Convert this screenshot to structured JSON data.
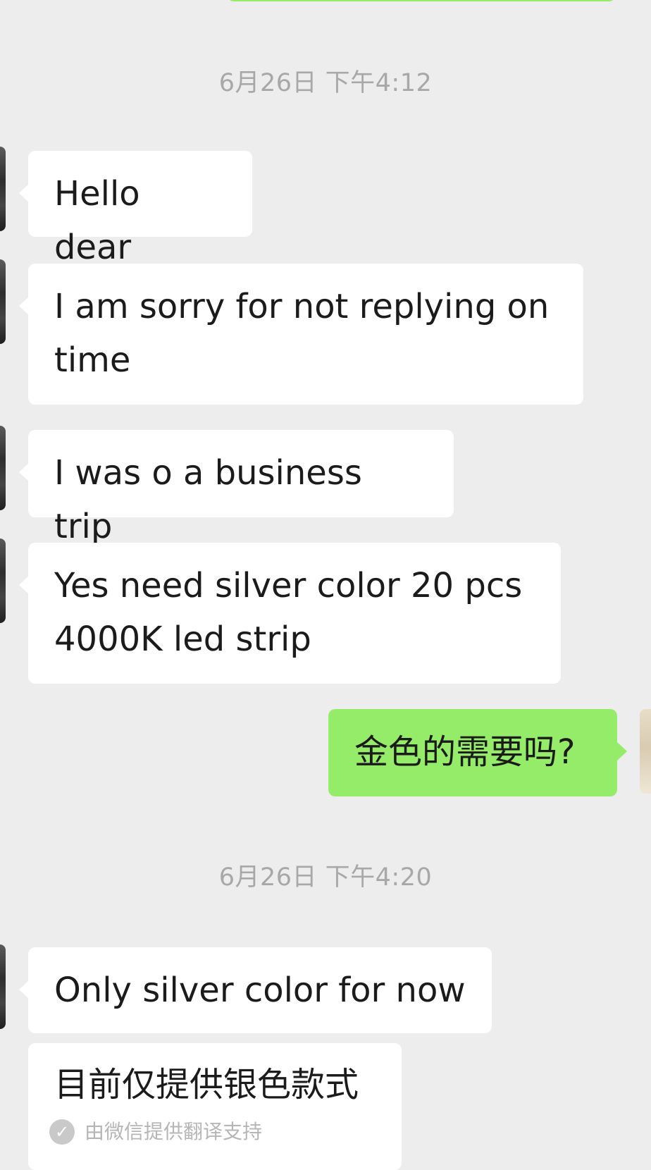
{
  "colors": {
    "background": "#EDEDED",
    "incoming_bubble": "#FFFFFF",
    "outgoing_bubble": "#95EC69",
    "timestamp_text": "#A8A8A8"
  },
  "timestamps": [
    {
      "label": "6月26日 下午4:12"
    },
    {
      "label": "6月26日 下午4:20"
    }
  ],
  "messages": [
    {
      "direction": "incoming",
      "text": "Hello dear"
    },
    {
      "direction": "incoming",
      "text": "I am sorry for not replying on time"
    },
    {
      "direction": "incoming",
      "text": "I was o a business trip"
    },
    {
      "direction": "incoming",
      "text": "Yes need silver color 20 pcs 4000K led strip"
    },
    {
      "direction": "outgoing",
      "text": "金色的需要吗?"
    },
    {
      "direction": "incoming",
      "text": "Only silver color for now"
    },
    {
      "direction": "incoming",
      "text": "目前仅提供银色款式"
    }
  ],
  "translation_footer": {
    "icon": "check-circle-icon",
    "text": "由微信提供翻译支持"
  }
}
